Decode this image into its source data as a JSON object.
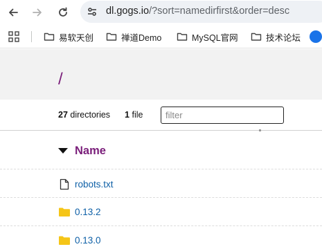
{
  "browser": {
    "url_host": "dl.gogs.io",
    "url_rest": "/?sort=namedirfirst&order=desc"
  },
  "bookmarks": [
    {
      "label": "易软天创"
    },
    {
      "label": "禅道Demo"
    },
    {
      "label": "MySQL官网"
    },
    {
      "label": "技术论坛"
    }
  ],
  "listing": {
    "path": "/",
    "dir_count": "27",
    "dir_label": "directories",
    "file_count": "1",
    "file_label": "file",
    "filter_placeholder": "filter",
    "column_name": "Name",
    "rows": [
      {
        "name": "robots.txt",
        "type": "file"
      },
      {
        "name": "0.13.2",
        "type": "folder"
      },
      {
        "name": "0.13.0",
        "type": "folder"
      }
    ]
  },
  "colors": {
    "accent_purple": "#7a1e7a",
    "link_blue": "#0d5fa6",
    "folder_yellow": "#f5c518"
  }
}
